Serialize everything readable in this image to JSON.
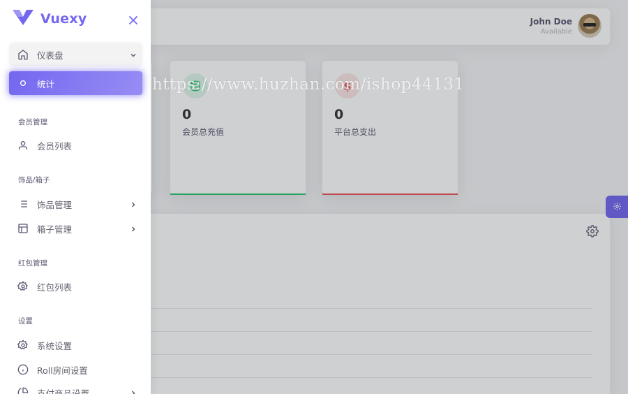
{
  "brand": {
    "name": "Vuexy",
    "accent": "#7367f0"
  },
  "user": {
    "name": "John Doe",
    "status": "Available"
  },
  "sidebar": {
    "dashboard": {
      "label": "仪表盘",
      "icon": "home-icon"
    },
    "active_item": {
      "label": "统计",
      "icon": "circle-icon"
    },
    "sections": [
      {
        "header": "会员管理",
        "items": [
          {
            "label": "会员列表",
            "icon": "user-icon"
          }
        ]
      },
      {
        "header": "饰品/箱子",
        "items": [
          {
            "label": "饰品管理",
            "icon": "list-icon"
          },
          {
            "label": "箱子管理",
            "icon": "layout-icon"
          }
        ]
      },
      {
        "header": "红包管理",
        "items": [
          {
            "label": "红包列表",
            "icon": "settings-icon"
          }
        ]
      },
      {
        "header": "设置",
        "items": [
          {
            "label": "系统设置",
            "icon": "settings-icon"
          },
          {
            "label": "Roll房间设置",
            "icon": "info-icon"
          },
          {
            "label": "支付商品设置",
            "icon": "pie-chart-icon"
          }
        ]
      }
    ]
  },
  "stats": [
    {
      "value": "0",
      "label": "会员总充值",
      "icon": "database-icon",
      "color": "#28c76f"
    },
    {
      "value": "0",
      "label": "平台总支出",
      "icon": "dollar-icon",
      "color": "#ea5455"
    }
  ],
  "watermark": "https://www.huzhan.com/ishop44131"
}
